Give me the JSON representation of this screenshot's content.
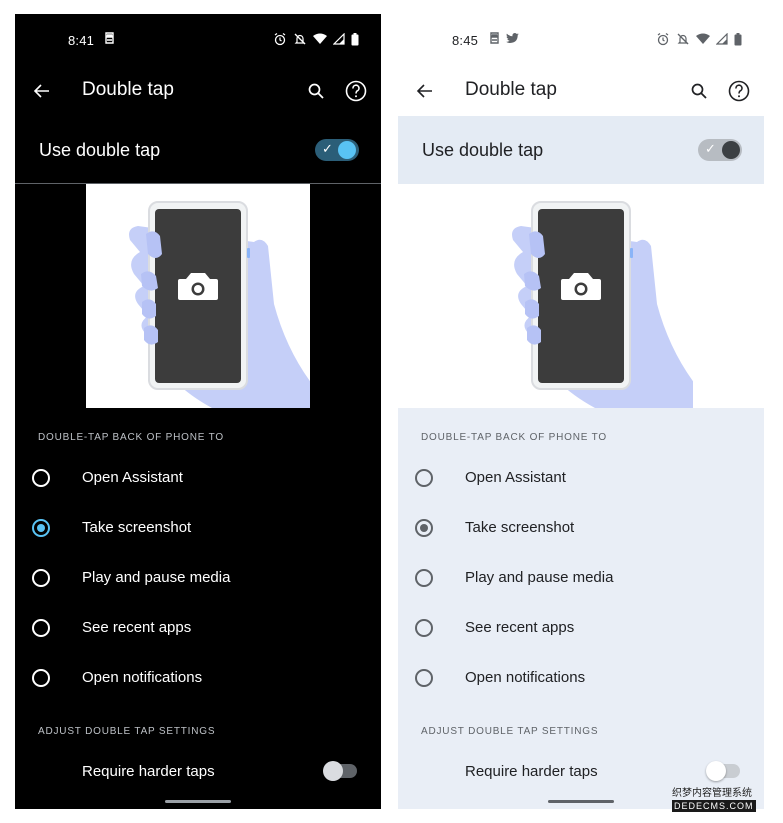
{
  "dark": {
    "status": {
      "time": "8:41"
    },
    "app_bar": {
      "title": "Double tap"
    },
    "main_toggle": {
      "label": "Use double tap",
      "state": "on"
    },
    "section1": "DOUBLE-TAP BACK OF PHONE TO",
    "options": [
      "Open Assistant",
      "Take screenshot",
      "Play and pause media",
      "See recent apps",
      "Open notifications"
    ],
    "selected_option": "Take screenshot",
    "section2": "ADJUST DOUBLE TAP SETTINGS",
    "harder_taps": {
      "label": "Require harder taps",
      "state": "off"
    }
  },
  "light": {
    "status": {
      "time": "8:45"
    },
    "app_bar": {
      "title": "Double tap"
    },
    "main_toggle": {
      "label": "Use double tap",
      "state": "on"
    },
    "section1": "DOUBLE-TAP BACK OF PHONE TO",
    "options": [
      "Open Assistant",
      "Take screenshot",
      "Play and pause media",
      "See recent apps",
      "Open notifications"
    ],
    "selected_option": "Take screenshot",
    "section2": "ADJUST DOUBLE TAP SETTINGS",
    "harder_taps": {
      "label": "Require harder taps",
      "state": "off"
    }
  },
  "watermark": {
    "line1": "织梦内容管理系统",
    "line2": "DEDECMS.COM"
  },
  "colors": {
    "accent_dark": "#59c3f4",
    "hand": "#c5cff8",
    "phone_screen": "#3c3c3c"
  }
}
